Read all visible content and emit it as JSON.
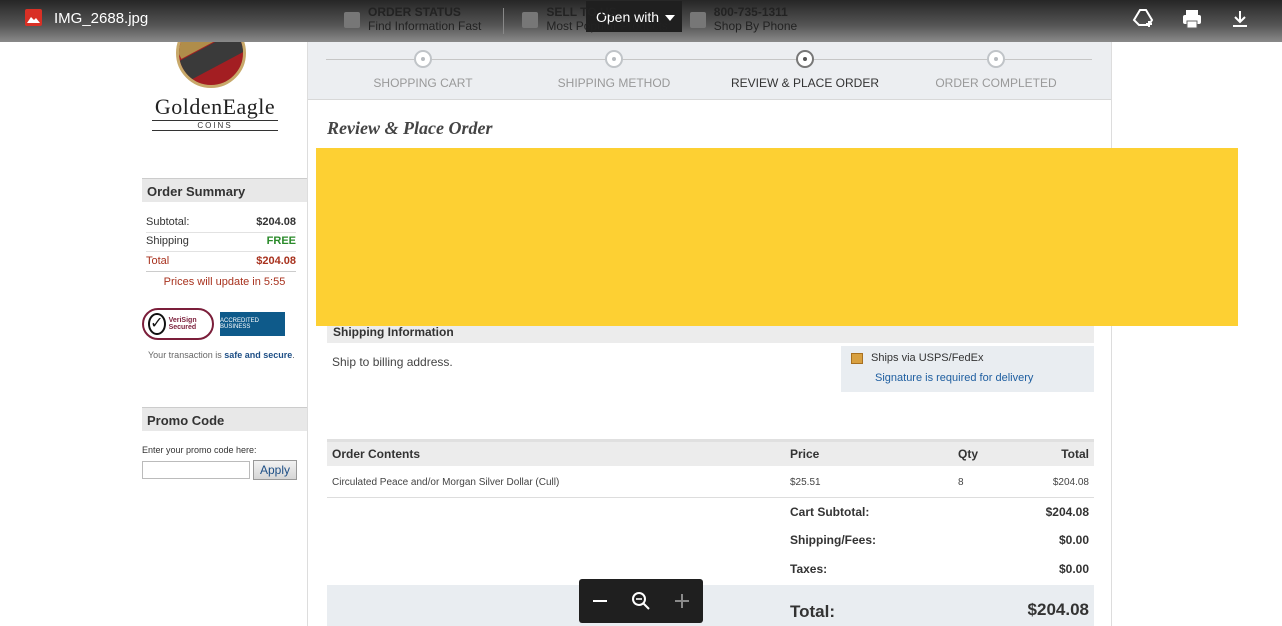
{
  "viewer": {
    "file_name": "IMG_2688.jpg",
    "open_with": "Open with",
    "actions": [
      "add-to-drive-icon",
      "print-icon",
      "download-icon"
    ]
  },
  "site_top": [
    {
      "title": "ORDER STATUS",
      "sub": "Find Information Fast"
    },
    {
      "title": "SELL TO US",
      "sub": "Most Popular Products"
    },
    {
      "title": "800-735-1311",
      "sub": "Shop By Phone"
    }
  ],
  "logo": {
    "name": "GoldenEagle",
    "sub": "COINS"
  },
  "steps": [
    {
      "label": "SHOPPING CART",
      "active": false
    },
    {
      "label": "SHIPPING METHOD",
      "active": false
    },
    {
      "label": "REVIEW & PLACE ORDER",
      "active": true
    },
    {
      "label": "ORDER COMPLETED",
      "active": false
    }
  ],
  "page_title": "Review & Place Order",
  "summary": {
    "header": "Order Summary",
    "subtotal_label": "Subtotal:",
    "subtotal": "$204.08",
    "shipping_label": "Shipping",
    "shipping": "FREE",
    "total_label": "Total",
    "total": "$204.08",
    "update": "Prices will update in 5:55"
  },
  "seals": {
    "verisign": "VeriSign Secured",
    "bbb": "ACCREDITED BUSINESS"
  },
  "secure_note": {
    "prefix": "Your transaction is ",
    "bold": "safe and secure",
    "suffix": "."
  },
  "promo": {
    "header": "Promo Code",
    "label": "Enter your promo code here:",
    "placeholder": "",
    "button": "Apply"
  },
  "shipping_info": {
    "header": "Shipping Information",
    "text": "Ship to billing address.",
    "method": "Ships via USPS/FedEx",
    "note": "Signature is required for delivery"
  },
  "order": {
    "headers": {
      "item": "Order Contents",
      "price": "Price",
      "qty": "Qty",
      "total": "Total"
    },
    "rows": [
      {
        "item": "Circulated Peace and/or Morgan Silver Dollar (Cull)",
        "price": "$25.51",
        "qty": "8",
        "total": "$204.08"
      }
    ],
    "cart_subtotal_label": "Cart Subtotal:",
    "cart_subtotal": "$204.08",
    "shipping_label": "Shipping/Fees:",
    "shipping": "$0.00",
    "taxes_label": "Taxes:",
    "taxes": "$0.00",
    "total_label": "Total:",
    "total": "$204.08"
  },
  "colors": {
    "redaction": "#fdd033",
    "accent_red": "#a8321e",
    "free_green": "#2a8a2a",
    "link_blue": "#1e5ea0"
  }
}
